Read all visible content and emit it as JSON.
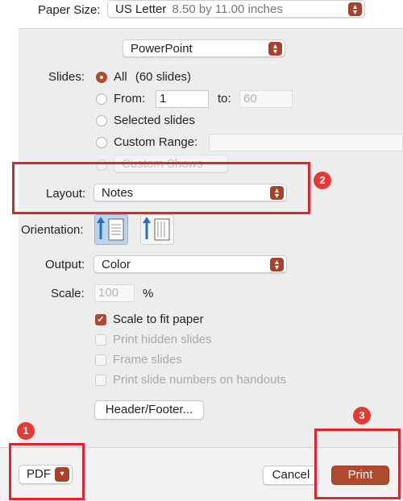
{
  "paper_size": {
    "label": "Paper Size:",
    "value": "US Letter",
    "detail": "8.50 by 11.00 inches"
  },
  "app_select": {
    "value": "PowerPoint"
  },
  "slides": {
    "label": "Slides:",
    "all_label": "All",
    "all_detail": "(60 slides)",
    "from_label": "From:",
    "from_value": "1",
    "to_label": "to:",
    "to_value": "60",
    "selected_label": "Selected slides",
    "custom_range_label": "Custom Range:",
    "custom_shows_label": "Custom Shows"
  },
  "layout": {
    "label": "Layout:",
    "value": "Notes"
  },
  "orientation": {
    "label": "Orientation:"
  },
  "output": {
    "label": "Output:",
    "value": "Color"
  },
  "scale": {
    "label": "Scale:",
    "value": "100",
    "unit": "%"
  },
  "options": {
    "scale_fit": "Scale to fit paper",
    "hidden": "Print hidden slides",
    "frame": "Frame slides",
    "numbers": "Print slide numbers on handouts"
  },
  "header_footer_label": "Header/Footer...",
  "footer": {
    "pdf_label": "PDF",
    "cancel_label": "Cancel",
    "print_label": "Print"
  },
  "annotations": {
    "b1": "1",
    "b2": "2",
    "b3": "3"
  },
  "colors": {
    "accent": "#b04a2e",
    "highlight": "#e0262d"
  }
}
